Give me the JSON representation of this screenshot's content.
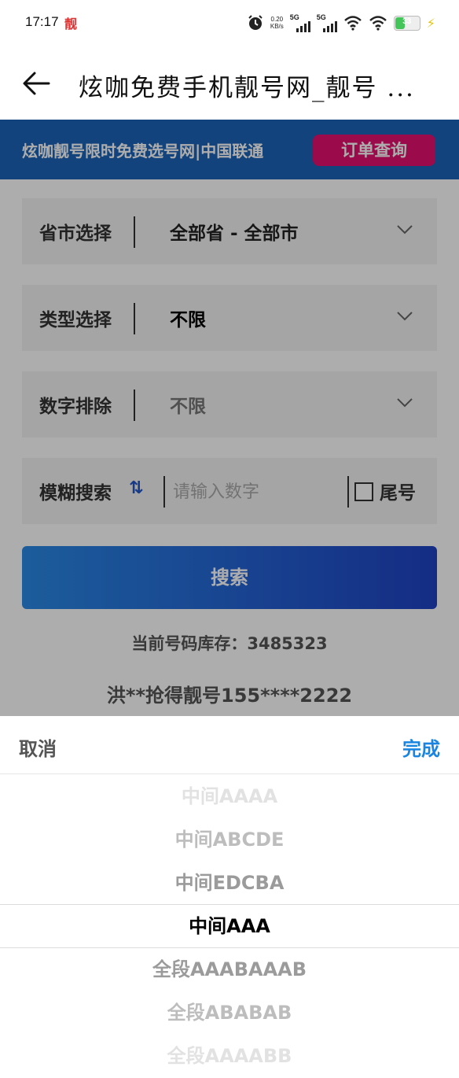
{
  "status_bar": {
    "time": "17:17",
    "app_badge": "靓",
    "speed_value": "0.20",
    "speed_unit": "KB/s",
    "net1": "5G",
    "net2": "5G",
    "battery": "33"
  },
  "title_bar": {
    "title": "炫咖免费手机靓号网_靓号 ..."
  },
  "banner": {
    "text": "炫咖靓号限时免费选号网|中国联通",
    "order_button": "订单查询"
  },
  "form": {
    "region": {
      "label": "省市选择",
      "value": "全部省 - 全部市"
    },
    "type": {
      "label": "类型选择",
      "value": "不限"
    },
    "exclude": {
      "label": "数字排除",
      "value": "不限"
    },
    "fuzzy": {
      "label": "模糊搜索",
      "sort_icon": "⇅",
      "placeholder": "请输入数字",
      "checkbox_label": "尾号"
    },
    "search_button": "搜索",
    "stock_text": "当前号码库存：3485323",
    "grab_text": "洪**抢得靓号155****2222"
  },
  "picker": {
    "cancel": "取消",
    "done": "完成",
    "options": [
      "中间AAAA",
      "中间ABCDE",
      "中间EDCBA",
      "中间AAA",
      "全段AAABAAAB",
      "全段ABABAB",
      "全段AAAABB"
    ],
    "selected": "中间AAA"
  },
  "colors": {
    "banner": "#1b63b7",
    "order_button": "#e5106e",
    "search_button_start": "#2a89e6",
    "search_button_end": "#1f42c4",
    "done": "#1a85e0"
  },
  "icons": [
    "back-arrow-icon",
    "alarm-icon",
    "signal-icon",
    "wifi-icon",
    "battery-icon",
    "charging-icon",
    "chevron-down-icon",
    "sort-icon",
    "checkbox-icon"
  ]
}
